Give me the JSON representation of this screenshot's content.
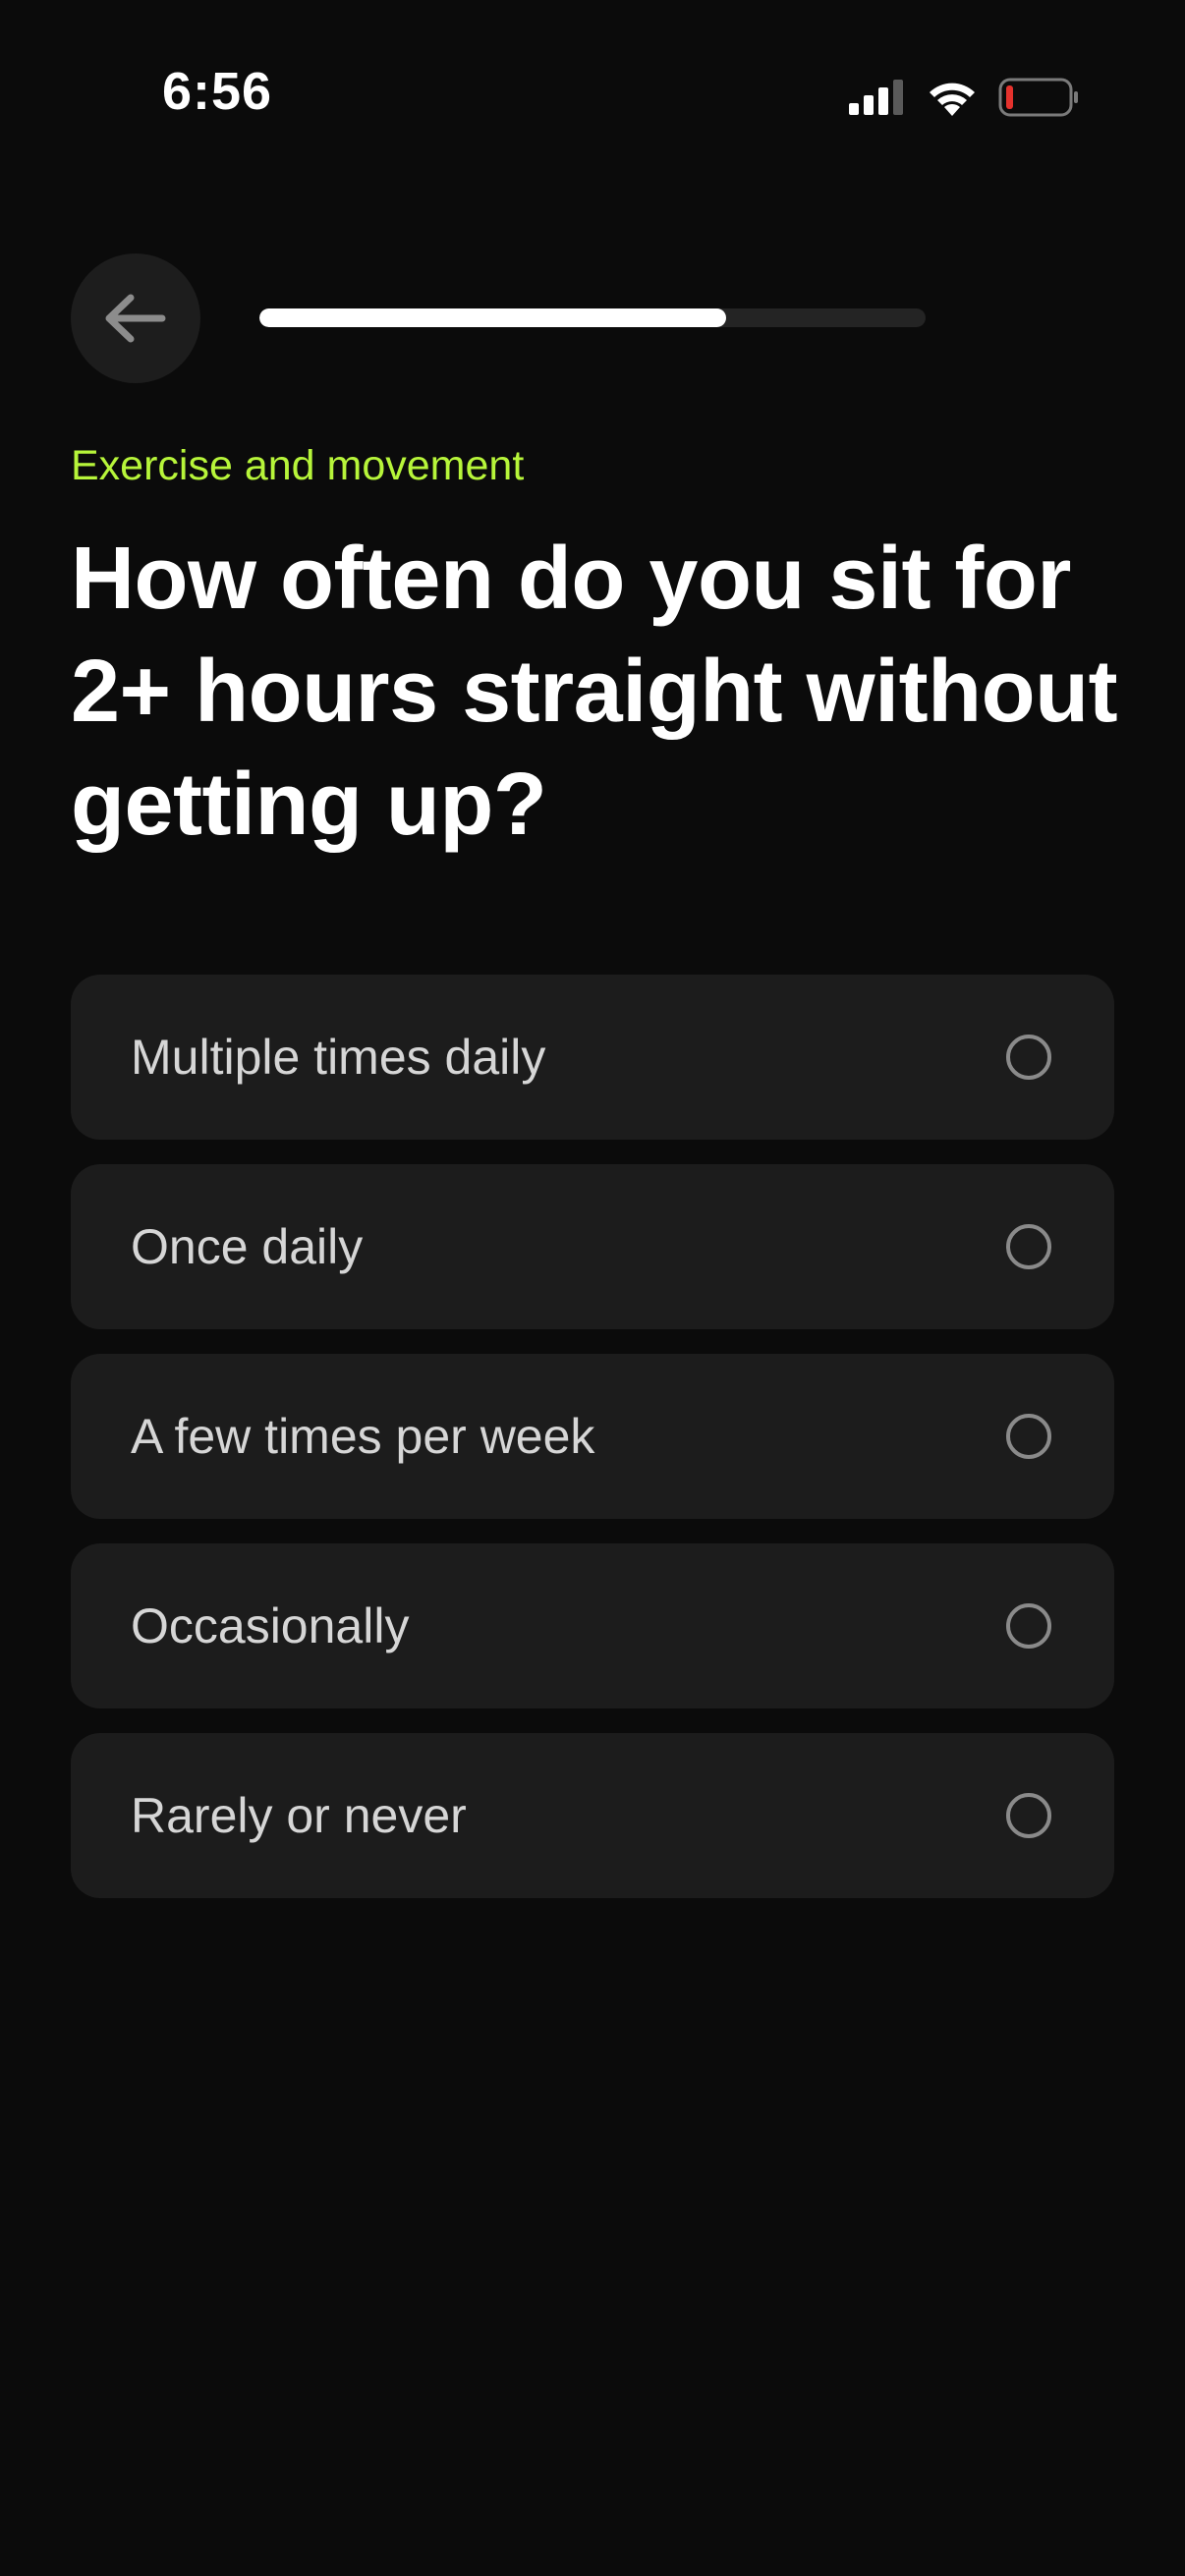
{
  "status_bar": {
    "time": "6:56",
    "icons": [
      "cellular-signal-icon",
      "wifi-icon",
      "battery-low-icon"
    ],
    "battery_color": "#e5322d"
  },
  "header": {
    "back_icon": "arrow-left-icon",
    "progress_fraction": 0.7
  },
  "category": "Exercise and movement",
  "question": "How often do you sit for 2+ hours straight without getting up?",
  "options": [
    {
      "label": "Multiple times daily",
      "selected": false
    },
    {
      "label": "Once daily",
      "selected": false
    },
    {
      "label": "A few times per week",
      "selected": false
    },
    {
      "label": "Occasionally",
      "selected": false
    },
    {
      "label": "Rarely or never",
      "selected": false
    }
  ],
  "colors": {
    "background": "#0b0b0b",
    "accent": "#b7f53a",
    "card": "#1c1c1c"
  }
}
